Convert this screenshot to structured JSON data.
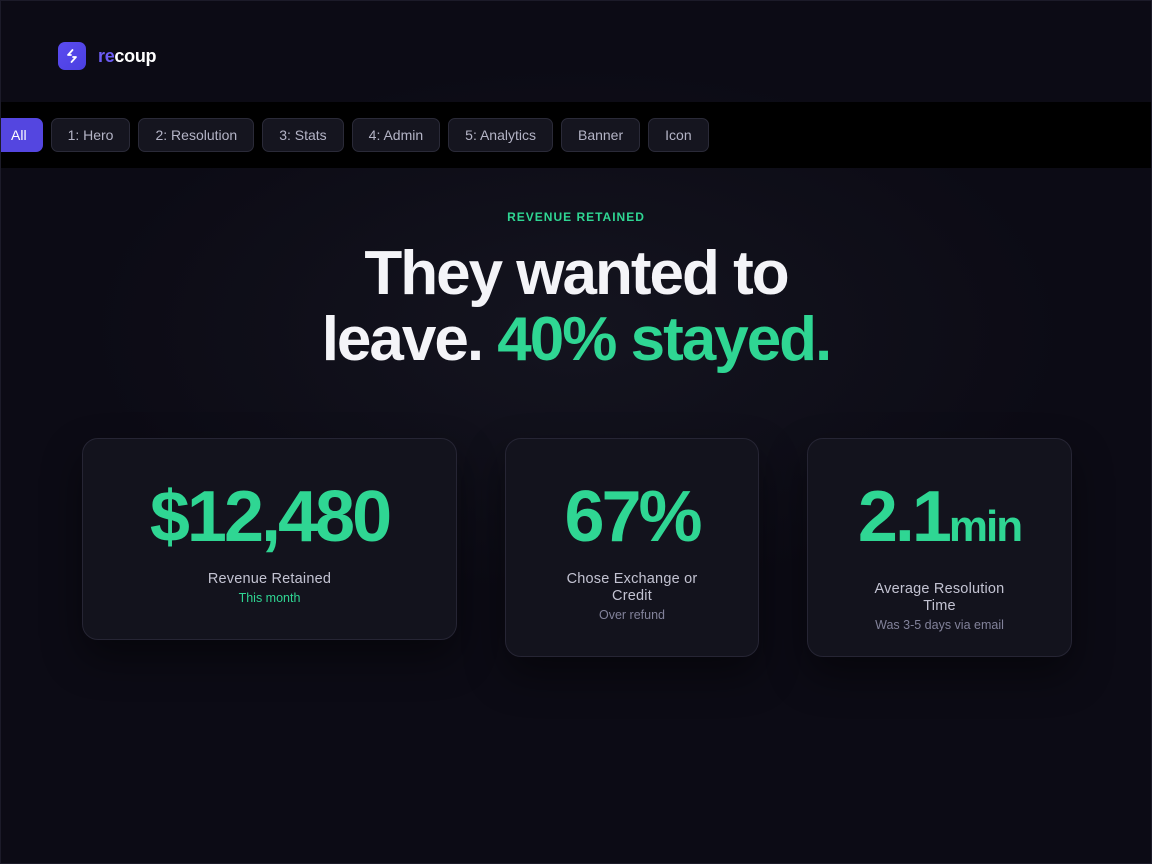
{
  "brand": {
    "name_prefix": "re",
    "name_suffix": "coup",
    "logo_icon": "link-arrows-icon",
    "accent_color": "#5b4cf0"
  },
  "tabs": [
    {
      "label": "All",
      "active": true
    },
    {
      "label": "1: Hero",
      "active": false
    },
    {
      "label": "2: Resolution",
      "active": false
    },
    {
      "label": "3: Stats",
      "active": false
    },
    {
      "label": "4: Admin",
      "active": false
    },
    {
      "label": "5: Analytics",
      "active": false
    },
    {
      "label": "Banner",
      "active": false
    },
    {
      "label": "Icon",
      "active": false
    }
  ],
  "hero": {
    "eyebrow": "REVENUE RETAINED",
    "line1": "They wanted to",
    "line2_plain": "leave. ",
    "line2_accent": "40% stayed.",
    "accent_color": "#2fd693"
  },
  "stats": {
    "revenue": {
      "value": "$12,480",
      "label": "Revenue Retained",
      "sub": "This month"
    },
    "exchange": {
      "value": "67%",
      "label": "Chose Exchange or Credit",
      "sub": "Over refund"
    },
    "time": {
      "value": "2.1",
      "unit": "min",
      "label": "Average Resolution Time",
      "sub": "Was 3-5 days via email"
    }
  }
}
